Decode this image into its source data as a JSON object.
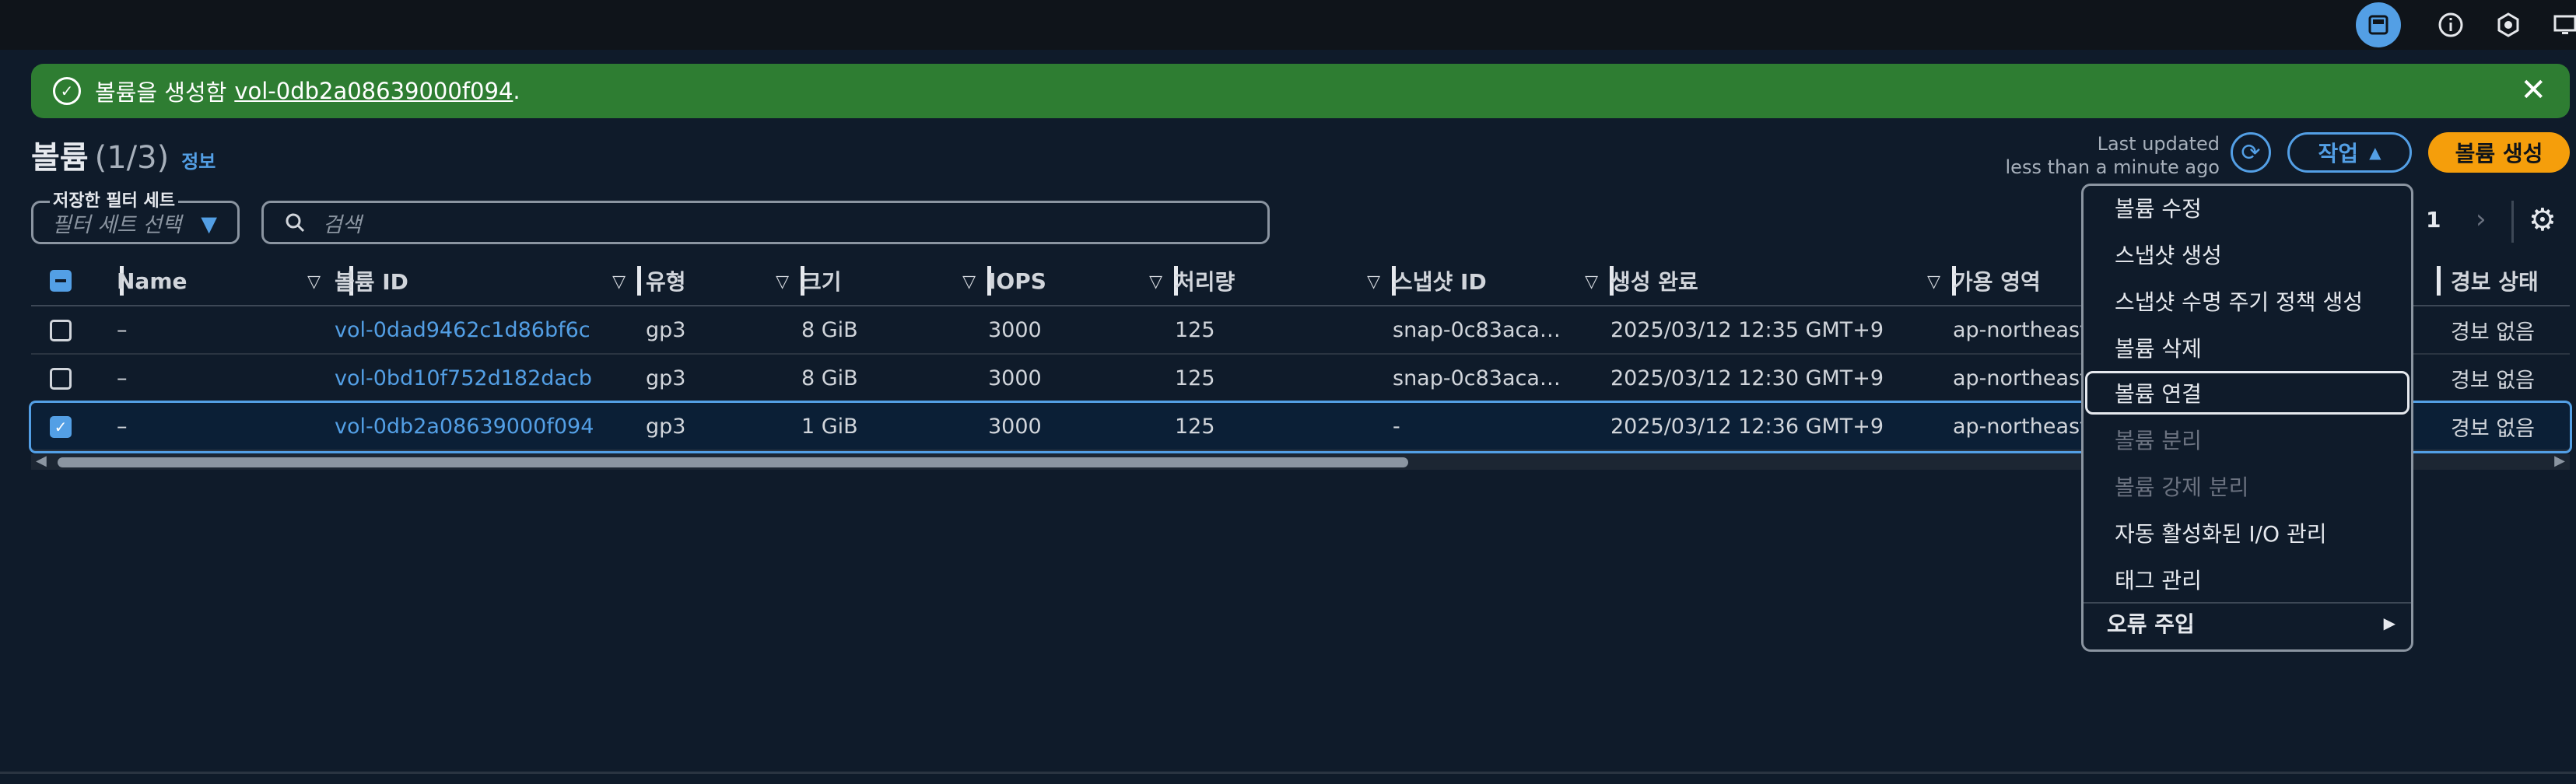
{
  "topbar": {
    "icons": [
      "panel-icon",
      "info-icon",
      "settings-hex-icon",
      "screen-icon"
    ]
  },
  "flash": {
    "message": "볼륨을 생성함",
    "volume_link": "vol-0db2a08639000f094",
    "suffix": "."
  },
  "header": {
    "title": "볼륨",
    "count": "(1/3)",
    "info": "정보",
    "last_updated_label": "Last updated",
    "last_updated_value": "less than a minute ago",
    "actions_label": "작업",
    "create_label": "볼륨 생성"
  },
  "filter": {
    "saved_set_label": "저장한 필터 세트",
    "saved_set_placeholder": "필터 세트 선택",
    "search_placeholder": "검색"
  },
  "pagination": {
    "current_page": "1"
  },
  "table": {
    "columns": [
      "Name",
      "볼륨 ID",
      "유형",
      "크기",
      "IOPS",
      "처리량",
      "스냅샷 ID",
      "생성 완료",
      "가용 영역",
      "경보 상태"
    ],
    "rows": [
      {
        "name": "–",
        "volume_id": "vol-0dad9462c1d86bf6c",
        "type": "gp3",
        "size": "8 GiB",
        "iops": "3000",
        "throughput": "125",
        "snapshot": "snap-0c83aca…",
        "created": "2025/03/12 12:35 GMT+9",
        "az": "ap-northeast",
        "alarm": "경보 없음",
        "selected": false
      },
      {
        "name": "–",
        "volume_id": "vol-0bd10f752d182dacb",
        "type": "gp3",
        "size": "8 GiB",
        "iops": "3000",
        "throughput": "125",
        "snapshot": "snap-0c83aca…",
        "created": "2025/03/12 12:30 GMT+9",
        "az": "ap-northeast",
        "alarm": "경보 없음",
        "selected": false
      },
      {
        "name": "–",
        "volume_id": "vol-0db2a08639000f094",
        "type": "gp3",
        "size": "1 GiB",
        "iops": "3000",
        "throughput": "125",
        "snapshot": "-",
        "created": "2025/03/12 12:36 GMT+9",
        "az": "ap-northeast",
        "alarm": "경보 없음",
        "selected": true
      }
    ]
  },
  "actions_menu": {
    "items": [
      {
        "label": "볼륨 수정",
        "disabled": false
      },
      {
        "label": "스냅샷 생성",
        "disabled": false
      },
      {
        "label": "스냅샷 수명 주기 정책 생성",
        "disabled": false
      },
      {
        "label": "볼륨 삭제",
        "disabled": false
      },
      {
        "label": "볼륨 연결",
        "disabled": false,
        "focused": true
      },
      {
        "label": "볼륨 분리",
        "disabled": true
      },
      {
        "label": "볼륨 강제 분리",
        "disabled": true
      },
      {
        "label": "자동 활성화된 I/O 관리",
        "disabled": false
      },
      {
        "label": "태그 관리",
        "disabled": false
      }
    ],
    "submenu_label": "오류 주입"
  },
  "colors": {
    "accent": "#539fe5",
    "success": "#2e7d32",
    "primary_button": "#f59e0b",
    "background": "#0f1b2a"
  }
}
